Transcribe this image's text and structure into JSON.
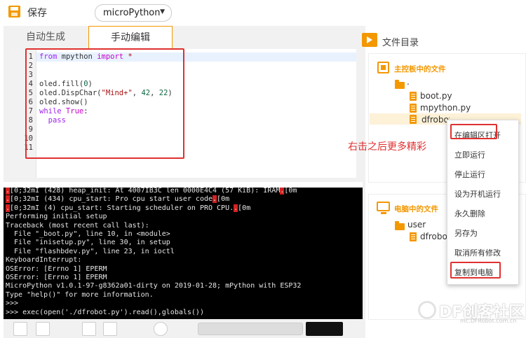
{
  "toolbar": {
    "save_label": "保存",
    "firmware_select": "microPython",
    "save_icon": "save-icon",
    "caret_icon": "chevron-down-icon"
  },
  "tabs": {
    "auto": "自动生成",
    "manual": "手动编辑"
  },
  "editor": {
    "line_numbers": [
      "1",
      "2",
      "3",
      "4",
      "5",
      "6",
      "7",
      "8",
      "9",
      "10",
      "11"
    ],
    "code": {
      "l1_kw1": "from",
      "l1_mod": " mpython ",
      "l1_kw2": "import",
      "l1_star": " *",
      "l4": "oled.fill(",
      "l4_num": "0",
      "l4_end": ")",
      "l5": "oled.DispChar(",
      "l5_str": "\"Mind+\"",
      "l5_sep": ", ",
      "l5_num1": "42",
      "l5_sep2": ", ",
      "l5_num2": "22",
      "l5_end": ")",
      "l6": "oled.show()",
      "l7_kw": "while",
      "l7_true": " True",
      "l7_end": ":",
      "l8_kw": "  pass"
    }
  },
  "terminal": {
    "esc": ".",
    "l1a": "[0;32mI (428) heap_init: At 4007IB3C len 0000E4C4 (57 KiB): IRAM",
    "l1b": "[0m",
    "l2a": "[0;32mI (434) cpu_start: Pro cpu start user code",
    "l2b": "[0m",
    "l3a": "[0;32mI (4) cpu_start: Starting scheduler on PRO CPU.",
    "l3b": "[0m",
    "lines": [
      "Performing initial setup",
      "Traceback (most recent call last):",
      "  File \"_boot.py\", line 10, in <module>",
      "  File \"inisetup.py\", line 30, in setup",
      "  File \"flashbdev.py\", line 23, in ioctl",
      "KeyboardInterrupt:",
      "OSError: [Errno 1] EPERM",
      "OSError: [Errno 1] EPERM",
      "MicroPython v1.0.1-97-g8362a01-dirty on 2019-01-28; mPython with ESP32",
      "Type \"help()\" for more information.",
      ">>>",
      ">>> exec(open('./dfrobot.py').read(),globals())"
    ]
  },
  "file_panel": {
    "title": "文件目录",
    "board_section": {
      "title": "主控板中的文件",
      "folder": ".",
      "files": [
        "boot.py",
        "mpython.py",
        "dfrobot.py"
      ]
    },
    "pc_section": {
      "title": "电脑中的文件",
      "folder": "user",
      "file": "dfrobot.py"
    }
  },
  "context_menu": {
    "items": [
      "在编辑区打开",
      "立即运行",
      "停止运行",
      "设为开机运行",
      "永久删除",
      "另存为",
      "取消所有修改",
      "复制到电脑"
    ]
  },
  "annotation": "右击之后更多精彩",
  "watermark": {
    "text": "DF创客社区",
    "url": "mc.DFRobot.com.cn"
  },
  "colors": {
    "accent": "#f39800",
    "highlight_red": "#e03030",
    "terminal_bg": "#000000"
  }
}
